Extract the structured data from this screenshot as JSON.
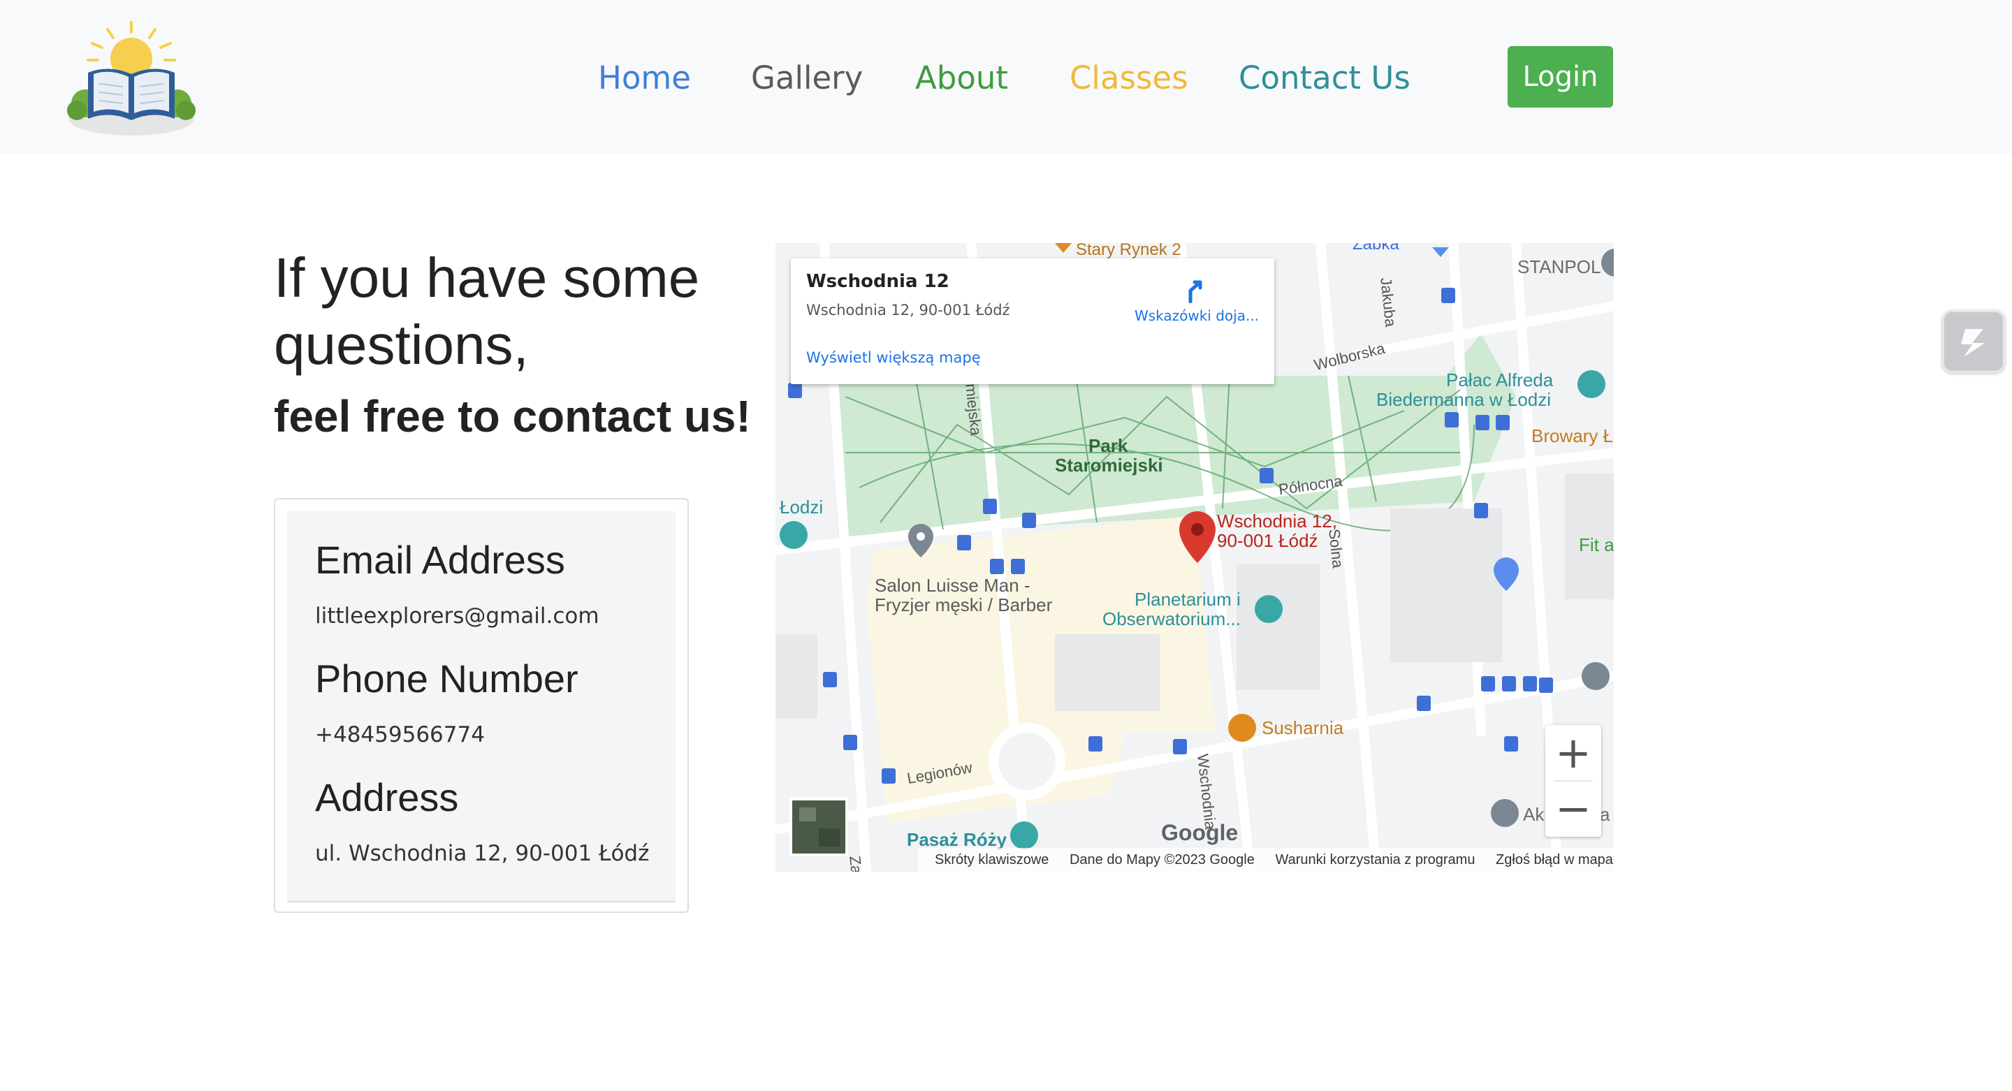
{
  "nav": {
    "links": [
      "Home",
      "Gallery",
      "About",
      "Classes",
      "Contact Us"
    ],
    "colors": [
      "#3f7fd8",
      "#5a5a5a",
      "#3f9b3f",
      "#f0b93a",
      "#2e8f9a"
    ],
    "login_label": "Login",
    "login_color": "#4caf50"
  },
  "main": {
    "heading": "If you have some questions,",
    "subheading": "feel free to contact us!"
  },
  "contact": {
    "email_label": "Email Address",
    "email_value": "littleexplorers@gmail.com",
    "phone_label": "Phone Number",
    "phone_value": "+48459566774",
    "address_label": "Address",
    "address_value": "ul. Wschodnia 12, 90-001 Łódź"
  },
  "map": {
    "card_title": "Wschodnia 12",
    "card_address": "Wschodnia 12, 90-001 Łódź",
    "directions_label": "Wskazówki doja...",
    "bigger_map_label": "Wyświetl większą mapę",
    "places": {
      "stary_rynek": "Stary Rynek 2",
      "zabka": "Żabka",
      "stanpol": "STANPOL",
      "palac_line1": "Pałac Alfreda",
      "palac_line2": "Biedermanna w Łodzi",
      "browary": "Browary Ł",
      "park_line1": "Park",
      "park_line2": "Staromiejski",
      "lodzi": "Łodzi",
      "marker_line1": "Wschodnia 12,",
      "marker_line2": "90-001 Łódź",
      "fit": "Fit a",
      "salon_line1": "Salon Luisse Man -",
      "salon_line2": "Fryzjer męski / Barber",
      "planetarium_line1": "Planetarium i",
      "planetarium_line2": "Obserwatorium...",
      "susharnia": "Susharnia",
      "pasaz": "Pasaż Róży",
      "ak": "Ak",
      "a": "a"
    },
    "streets": {
      "wolborska": "Wolborska",
      "polnocna": "Północna",
      "solna": "Solna",
      "jakuba": "Jakuba",
      "legionow": "Legionów",
      "wschodnia": "Wschodnia",
      "miejska": "miejska",
      "za": "Za"
    },
    "google_logo": "Google",
    "footer": {
      "shortcuts": "Skróty klawiszowe",
      "data": "Dane do Mapy ©2023 Google",
      "terms": "Warunki korzystania z programu",
      "report": "Zgłoś błąd w mapach"
    },
    "zoom_in": "+",
    "zoom_out": "−"
  }
}
